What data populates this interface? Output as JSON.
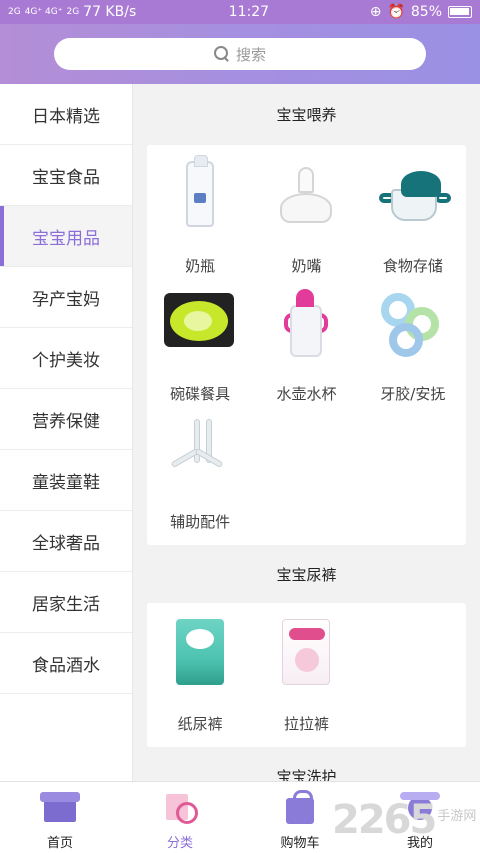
{
  "status_bar": {
    "signal_1": "2G",
    "signal_2": "4G⁺ 4G⁺",
    "signal_3": "2G",
    "speed": "77 KB/s",
    "time": "11:27",
    "battery": "85%"
  },
  "search": {
    "placeholder": "搜索"
  },
  "sidebar": {
    "items": [
      {
        "label": "日本精选"
      },
      {
        "label": "宝宝食品"
      },
      {
        "label": "宝宝用品"
      },
      {
        "label": "孕产宝妈"
      },
      {
        "label": "个护美妆"
      },
      {
        "label": "营养保健"
      },
      {
        "label": "童装童鞋"
      },
      {
        "label": "全球奢品"
      },
      {
        "label": "居家生活"
      },
      {
        "label": "食品酒水"
      }
    ],
    "active_index": 2
  },
  "content": {
    "sections": [
      {
        "title": "宝宝喂养",
        "items": [
          {
            "label": "奶瓶",
            "icon": "baby-bottle"
          },
          {
            "label": "奶嘴",
            "icon": "pacifier-nipple"
          },
          {
            "label": "食物存储",
            "icon": "food-storage-cup"
          },
          {
            "label": "碗碟餐具",
            "icon": "bowl-tableware"
          },
          {
            "label": "水壶水杯",
            "icon": "sippy-cup"
          },
          {
            "label": "牙胶/安抚",
            "icon": "teether-rings"
          },
          {
            "label": "辅助配件",
            "icon": "straw-accessories"
          }
        ]
      },
      {
        "title": "宝宝尿裤",
        "items": [
          {
            "label": "纸尿裤",
            "icon": "pampers-diaper-pack"
          },
          {
            "label": "拉拉裤",
            "icon": "merries-pullup-pack"
          }
        ]
      },
      {
        "title": "宝宝洗护",
        "items": []
      }
    ]
  },
  "tabbar": {
    "tabs": [
      {
        "label": "首页",
        "icon": "home-icon"
      },
      {
        "label": "分类",
        "icon": "category-icon"
      },
      {
        "label": "购物车",
        "icon": "cart-icon"
      },
      {
        "label": "我的",
        "icon": "profile-icon"
      }
    ],
    "active_index": 1
  },
  "watermark": {
    "number": "2265",
    "text": "手游网"
  },
  "colors": {
    "accent": "#8b6ed8",
    "header_start": "#b48ed6",
    "header_end": "#9a90e4"
  }
}
